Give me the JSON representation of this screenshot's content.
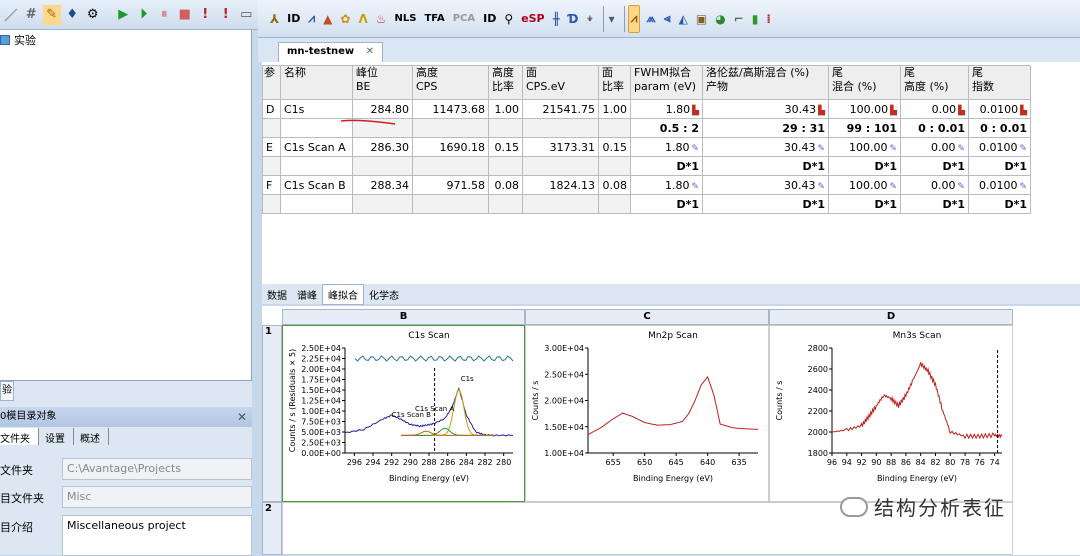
{
  "tree": {
    "root_label": "实验"
  },
  "left_panel": {
    "tab_stub": "验",
    "header": "0模目录对象",
    "subtabs": [
      "文件夹",
      "设置",
      "概述"
    ],
    "props": [
      {
        "key": "文件夹",
        "value": "C:\\Avantage\\Projects"
      },
      {
        "key": "目文件夹",
        "value": "Misc"
      }
    ],
    "desc_key": "目介绍",
    "desc_value": "Miscellaneous project"
  },
  "toolbar": {
    "items": [
      "NLS",
      "TFA",
      "PCA",
      "ID",
      "eSP"
    ]
  },
  "doc_tab": {
    "label": "mn-testnew"
  },
  "table": {
    "headers": [
      [
        "参",
        ""
      ],
      [
        "名称",
        ""
      ],
      [
        "峰位",
        "BE"
      ],
      [
        "高度",
        "CPS"
      ],
      [
        "高度",
        "比率"
      ],
      [
        "面",
        "CPS.eV"
      ],
      [
        "面",
        "比率"
      ],
      [
        "FWHM拟合",
        "param (eV)"
      ],
      [
        "洛伦兹/高斯混合 (%)",
        "产物"
      ],
      [
        "尾",
        "混合 (%)"
      ],
      [
        "尾",
        "高度 (%)"
      ],
      [
        "尾",
        "指数"
      ]
    ],
    "rows": [
      {
        "ref": "D",
        "name": "C1s",
        "be": "284.80",
        "height": "11473.68",
        "hratio": "1.00",
        "area": "21541.75",
        "aratio": "1.00",
        "fwhm": "1.80",
        "lg": "30.43",
        "tmix": "100.00",
        "theight": "0.00",
        "texp": "0.0100",
        "c_fwhm": "0.5 : 2",
        "c_lg": "29 : 31",
        "c_tmix": "99 : 101",
        "c_theight": "0 : 0.01",
        "c_texp": "0 : 0.01"
      },
      {
        "ref": "E",
        "name": "C1s Scan A",
        "be": "286.30",
        "height": "1690.18",
        "hratio": "0.15",
        "area": "3173.31",
        "aratio": "0.15",
        "fwhm": "1.80",
        "lg": "30.43",
        "tmix": "100.00",
        "theight": "0.00",
        "texp": "0.0100",
        "c_fwhm": "D*1",
        "c_lg": "D*1",
        "c_tmix": "D*1",
        "c_theight": "D*1",
        "c_texp": "D*1"
      },
      {
        "ref": "F",
        "name": "C1s Scan B",
        "be": "288.34",
        "height": "971.58",
        "hratio": "0.08",
        "area": "1824.13",
        "aratio": "0.08",
        "fwhm": "1.80",
        "lg": "30.43",
        "tmix": "100.00",
        "theight": "0.00",
        "texp": "0.0100",
        "c_fwhm": "D*1",
        "c_lg": "D*1",
        "c_tmix": "D*1",
        "c_theight": "D*1",
        "c_texp": "D*1"
      }
    ]
  },
  "bottom_tabs": [
    "数据",
    "谱峰",
    "峰拟合",
    "化学态"
  ],
  "grid": {
    "columns": [
      "B",
      "C",
      "D"
    ],
    "rows": [
      "1",
      "2"
    ]
  },
  "chart_data": [
    {
      "type": "line",
      "title": "C1s Scan",
      "xlabel": "Binding Energy (eV)",
      "ylabel": "Counts / s  (Residuals × 5)",
      "x_ticks": [
        "296",
        "294",
        "292",
        "290",
        "288",
        "286",
        "284",
        "282",
        "280"
      ],
      "y_ticks": [
        "0.00E+00",
        "2.50E+03",
        "5.00E+03",
        "7.50E+03",
        "1.00E+04",
        "1.25E+04",
        "1.50E+04",
        "1.75E+04",
        "2.00E+04",
        "2.25E+04",
        "2.50E+04"
      ],
      "xlim": [
        297,
        279
      ],
      "ylim": [
        0,
        25000
      ],
      "annotations": [
        "C1s",
        "C1s Scan A",
        "C1s Scan B"
      ],
      "series": [
        {
          "x": [
            297,
            295,
            293,
            292,
            291,
            290,
            289,
            288.3,
            287.5,
            286.3,
            285.5,
            284.8,
            284,
            283,
            282,
            281,
            279
          ],
          "values": [
            4800,
            5600,
            8000,
            9000,
            8000,
            6800,
            6400,
            6600,
            7000,
            8200,
            11000,
            15500,
            9000,
            5000,
            4300,
            4200,
            4200
          ]
        }
      ]
    },
    {
      "type": "line",
      "title": "Mn2p Scan",
      "xlabel": "Binding Energy (eV)",
      "ylabel": "Counts / s",
      "x_ticks": [
        "655",
        "650",
        "645",
        "640",
        "635"
      ],
      "y_ticks": [
        "1.00E+04",
        "1.50E+04",
        "2.00E+04",
        "2.50E+04",
        "3.00E+04"
      ],
      "xlim": [
        659,
        632
      ],
      "ylim": [
        10000,
        30000
      ],
      "series": [
        {
          "x": [
            659,
            657,
            655,
            653.5,
            652,
            650,
            648,
            646,
            644,
            643,
            642,
            641,
            640,
            639,
            638,
            636,
            634,
            632
          ],
          "values": [
            13500,
            14800,
            16500,
            17600,
            17000,
            15800,
            15300,
            15400,
            16000,
            17500,
            20000,
            23000,
            24500,
            21000,
            15500,
            14800,
            14600,
            14500
          ]
        }
      ]
    },
    {
      "type": "line",
      "title": "Mn3s Scan",
      "xlabel": "Binding Energy (eV)",
      "ylabel": "Counts / s",
      "x_ticks": [
        "96",
        "94",
        "92",
        "90",
        "88",
        "86",
        "84",
        "82",
        "80",
        "78",
        "76",
        "74"
      ],
      "y_ticks": [
        "1800",
        "2000",
        "2200",
        "2400",
        "2600",
        "2800"
      ],
      "xlim": [
        96,
        73
      ],
      "ylim": [
        1800,
        2800
      ],
      "series": [
        {
          "x": [
            96,
            94,
            92,
            91,
            90,
            89,
            88,
            87,
            86,
            85,
            84,
            83,
            82,
            81,
            80,
            78,
            76,
            74,
            73
          ],
          "values": [
            2000,
            2020,
            2060,
            2150,
            2250,
            2350,
            2320,
            2250,
            2350,
            2500,
            2650,
            2580,
            2450,
            2200,
            2000,
            1960,
            1960,
            1970,
            1960
          ]
        }
      ]
    }
  ],
  "watermark": "结构分析表征"
}
